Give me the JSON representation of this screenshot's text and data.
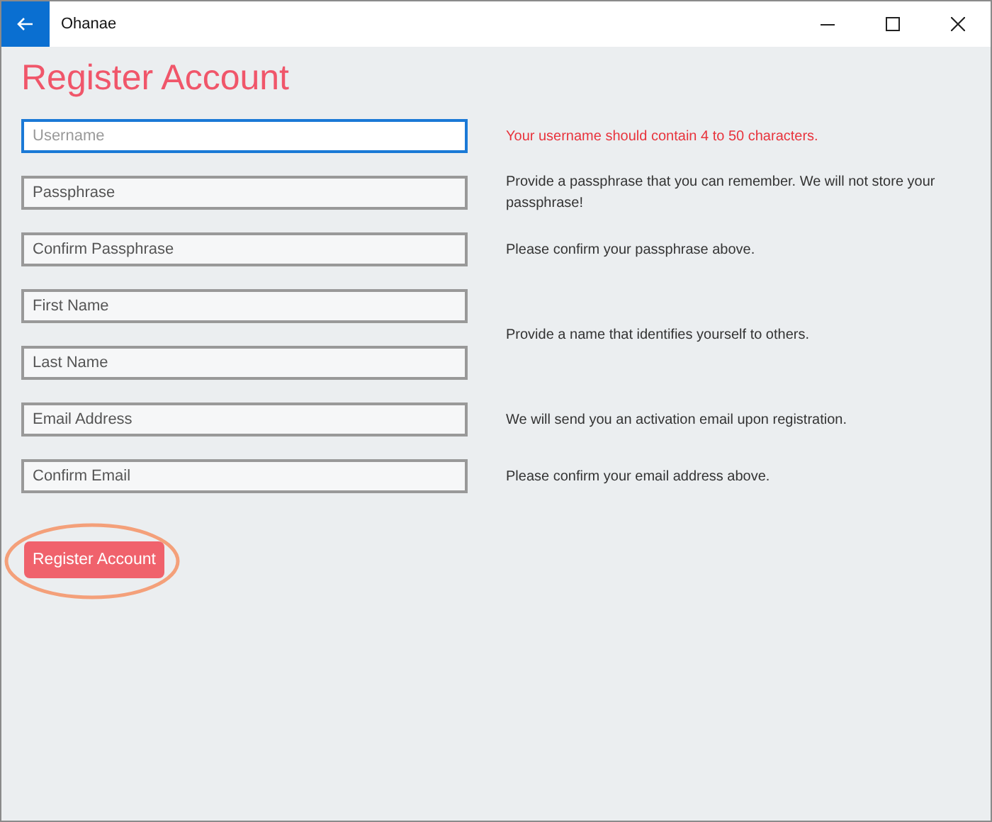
{
  "window": {
    "title": "Ohanae"
  },
  "heading": "Register Account",
  "fields": [
    {
      "placeholder": "Username",
      "focused": true,
      "hint": "Your username should contain 4 to 50 characters.",
      "error": true
    },
    {
      "placeholder": "Passphrase",
      "focused": false,
      "hint": "Provide a passphrase that you can remember. We will not store your passphrase!",
      "error": false
    },
    {
      "placeholder": "Confirm Passphrase",
      "focused": false,
      "hint": "Please confirm your passphrase above.",
      "error": false
    },
    {
      "placeholder": "First Name",
      "focused": false,
      "hint": "Provide a name that identifies yourself to others.",
      "error": false
    },
    {
      "placeholder": "Last Name",
      "focused": false
    },
    {
      "placeholder": "Email Address",
      "focused": false,
      "hint": "We will send you an activation email upon registration.",
      "error": false
    },
    {
      "placeholder": "Confirm Email",
      "focused": false,
      "hint": "Please confirm your email address above.",
      "error": false
    }
  ],
  "submit": {
    "label": "Register Account",
    "highlighted": true
  }
}
